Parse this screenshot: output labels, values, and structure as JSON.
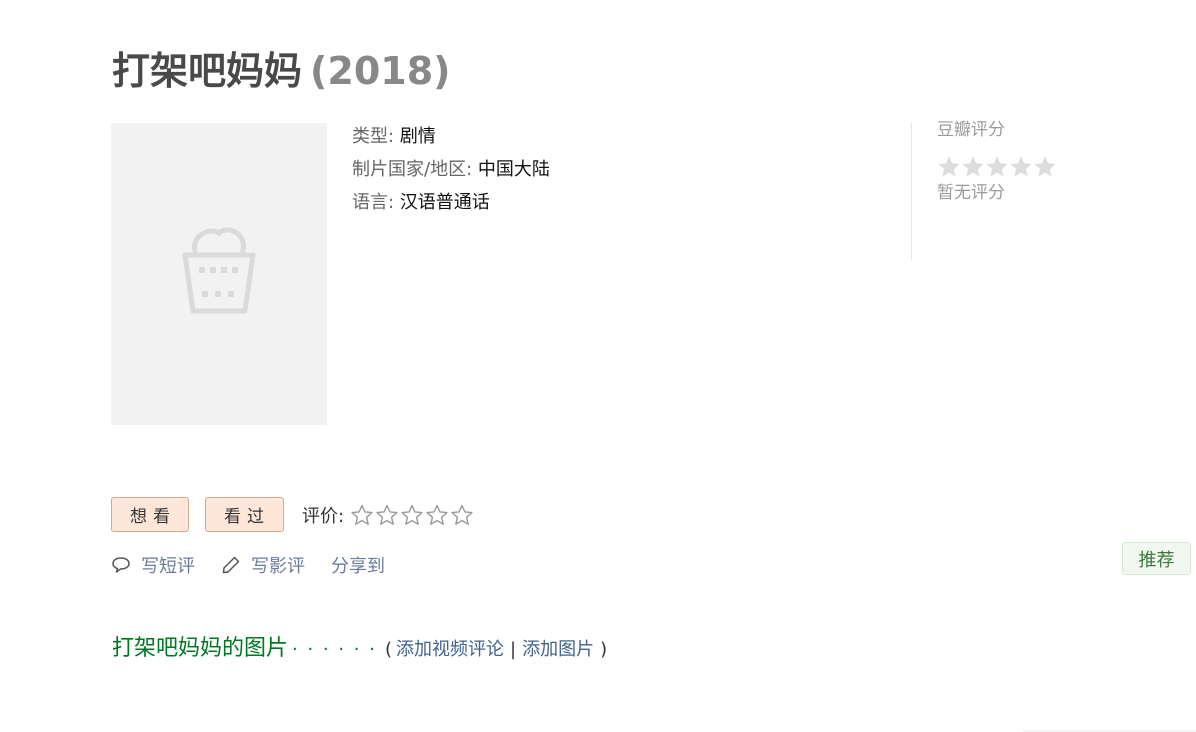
{
  "movie": {
    "title": "打架吧妈妈",
    "year": "(2018)"
  },
  "info": {
    "genre_label": "类型:",
    "genre_value": "剧情",
    "region_label": "制片国家/地区:",
    "region_value": "中国大陆",
    "language_label": "语言:",
    "language_value": "汉语普通话"
  },
  "rating": {
    "label": "豆瓣评分",
    "no_rating": "暂无评分",
    "star_color": "#dddddd"
  },
  "actions": {
    "want_label": "想看",
    "seen_label": "看过",
    "rate_label": "评价:",
    "user_stars": 0,
    "accent_color": "#fee7d8"
  },
  "links": {
    "short_review": "写短评",
    "review": "写影评",
    "share": "分享到"
  },
  "recommend_label": "推荐",
  "pictures": {
    "heading": "打架吧妈妈的图片",
    "dots": "· · · · · ·",
    "open_paren": "(",
    "add_video_review": "添加视频评论",
    "separator": "|",
    "add_picture": "添加图片",
    "close_paren": ")"
  }
}
